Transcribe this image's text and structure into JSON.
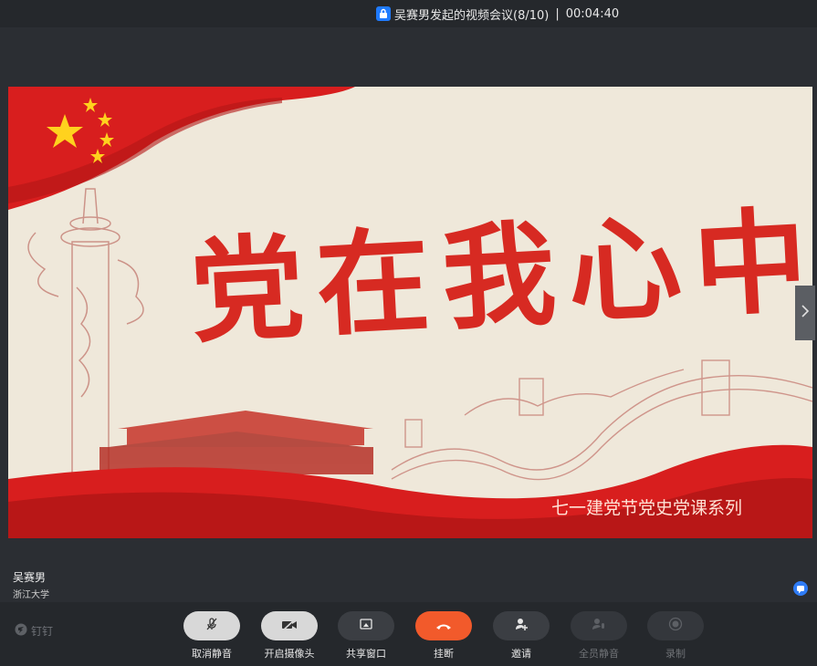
{
  "title": {
    "meeting_title": "吴赛男发起的视频会议(8/10)",
    "separator": "|",
    "elapsed": "00:04:40"
  },
  "slide": {
    "main_text": "党在我心中",
    "subtitle": "七一建党节党史党课系列"
  },
  "speaker": {
    "name": "吴赛男",
    "organization": "浙江大学"
  },
  "brand": {
    "name": "钉钉"
  },
  "controls": [
    {
      "label": "取消静音",
      "icon": "microphone-muted-icon",
      "enabled": true
    },
    {
      "label": "开启摄像头",
      "icon": "camera-off-icon",
      "enabled": true
    },
    {
      "label": "共享窗口",
      "icon": "share-window-icon",
      "enabled": true
    },
    {
      "label": "挂断",
      "icon": "hang-up-icon",
      "enabled": true
    },
    {
      "label": "邀请",
      "icon": "invite-user-icon",
      "enabled": true
    },
    {
      "label": "全员静音",
      "icon": "mute-all-icon",
      "enabled": false
    },
    {
      "label": "录制",
      "icon": "record-icon",
      "enabled": false
    }
  ],
  "colors": {
    "hangup": "#f25a2b",
    "accent_blue": "#2f7cf6",
    "flag_red": "#d81e1e"
  }
}
